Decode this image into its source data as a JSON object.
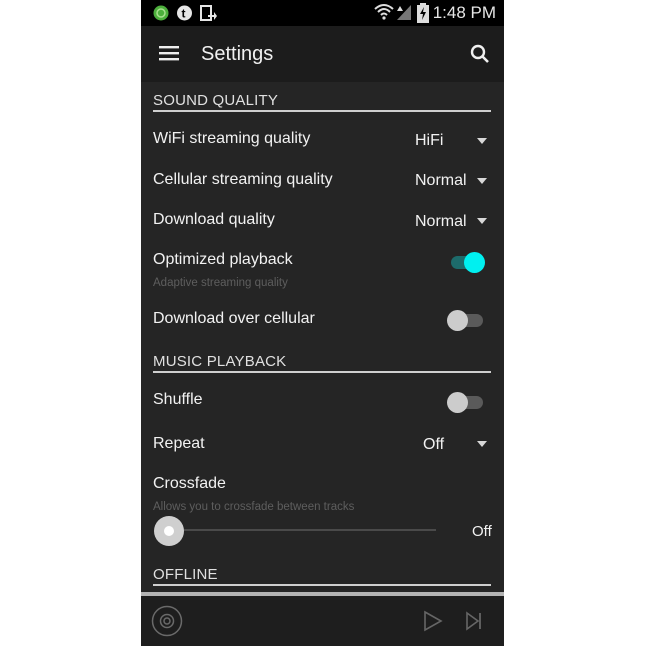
{
  "status_bar": {
    "time": "1:48 PM",
    "left_icons": [
      "app-notification-icon",
      "tumblr-notification-icon",
      "share-notification-icon"
    ],
    "right_icons": [
      "wifi-icon",
      "cellular-signal-icon",
      "battery-charging-icon"
    ]
  },
  "app_bar": {
    "menu_icon": "hamburger-menu-icon",
    "title": "Settings",
    "search_icon": "search-icon"
  },
  "sections": {
    "sound_quality": {
      "header": "SOUND QUALITY",
      "wifi_quality": {
        "label": "WiFi streaming quality",
        "value": "HiFi"
      },
      "cellular_quality": {
        "label": "Cellular streaming quality",
        "value": "Normal"
      },
      "download_quality": {
        "label": "Download quality",
        "value": "Normal"
      },
      "optimized_playback": {
        "label": "Optimized playback",
        "subtitle": "Adaptive streaming quality",
        "enabled": true
      },
      "download_over_cellular": {
        "label": "Download over cellular",
        "enabled": false
      }
    },
    "music_playback": {
      "header": "MUSIC PLAYBACK",
      "shuffle": {
        "label": "Shuffle",
        "enabled": false
      },
      "repeat": {
        "label": "Repeat",
        "value": "Off"
      },
      "crossfade": {
        "label": "Crossfade",
        "subtitle": "Allows you to crossfade between tracks",
        "value_label": "Off",
        "level": 0
      }
    },
    "offline": {
      "header": "OFFLINE"
    }
  },
  "player": {
    "disc_icon": "disc-icon",
    "play_icon": "play-icon",
    "skip_icon": "skip-next-icon"
  },
  "colors": {
    "accent": "#00f0f0",
    "accent_track": "#1d6b6b",
    "background": "#252525"
  }
}
